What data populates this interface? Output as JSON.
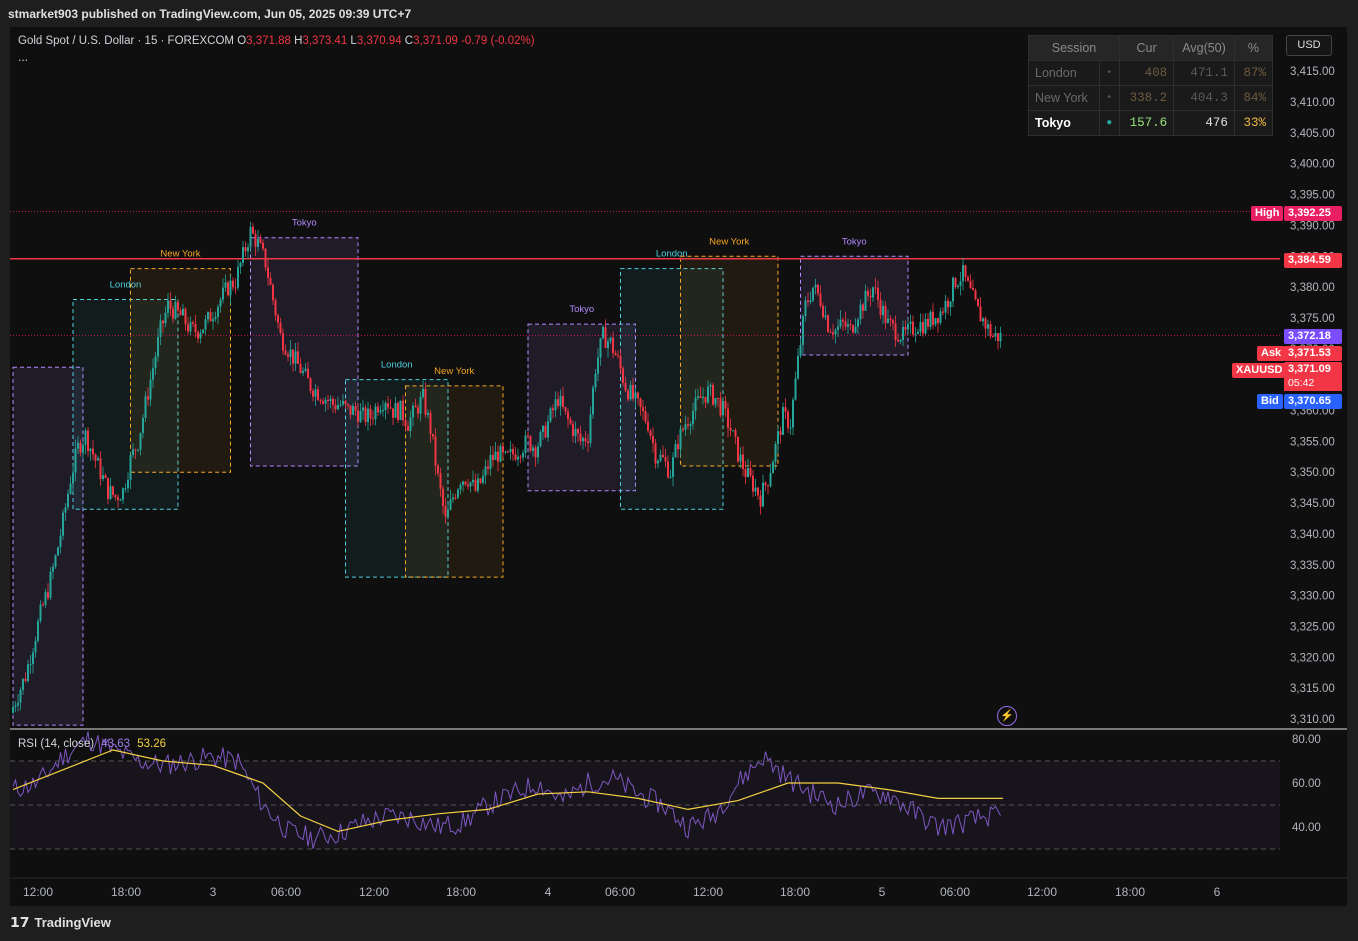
{
  "header": {
    "publisher": "stmarket903 published on TradingView.com, Jun 05, 2025 09:39 UTC+7"
  },
  "footer": {
    "brand": "TradingView",
    "brand_icon": "tradingview-logo-icon"
  },
  "legend": {
    "symbol": "Gold Spot / U.S. Dollar · 15 · FOREXCOM",
    "o_label": "O",
    "o": "3,371.88",
    "h_label": "H",
    "h": "3,373.41",
    "l_label": "L",
    "l": "3,370.94",
    "c_label": "C",
    "c": "3,371.09",
    "chg": "-0.79 (-0.02%)",
    "more": "..."
  },
  "currency": "USD",
  "session_table": {
    "headers": [
      "Session",
      "Cur",
      "Avg(50)",
      "%"
    ],
    "rows": [
      {
        "name": "London",
        "dot": "•",
        "cur": "408",
        "avg": "471.1",
        "pct": "87%",
        "active": false
      },
      {
        "name": "New York",
        "dot": "•",
        "cur": "338.2",
        "avg": "404.3",
        "pct": "84%",
        "active": false
      },
      {
        "name": "Tokyo",
        "dot": "●",
        "cur": "157.6",
        "avg": "476",
        "pct": "33%",
        "active": true
      }
    ]
  },
  "price_labels": {
    "high_tag": "High",
    "high": "3,392.25",
    "level": "3,384.59",
    "purple": "3,372.18",
    "ask_tag": "Ask",
    "ask": "3,371.53",
    "symbol_tag": "XAUUSD",
    "last": "3,371.09",
    "countdown": "05:42",
    "bid_tag": "Bid",
    "bid": "3,370.65"
  },
  "rsi_legend": {
    "label": "RSI (14, close)",
    "rsi": "43.63",
    "ma": "53.26"
  },
  "colors": {
    "up": "#26a69a",
    "down": "#f23645",
    "london": "#4dd0e1",
    "newyork": "#f5a623",
    "tokyo": "#b388ff",
    "rsi": "#7e57c2",
    "rsi_ma": "#f5d142",
    "level": "#f23645"
  },
  "chart_data": {
    "type": "candlestick",
    "title": "Gold Spot / U.S. Dollar · 15 · FOREXCOM",
    "price_axis": {
      "ticks": [
        "3,415.00",
        "3,410.00",
        "3,405.00",
        "3,400.00",
        "3,395.00",
        "3,390.00",
        "3,385.00",
        "3,380.00",
        "3,375.00",
        "3,370.00",
        "3,365.00",
        "3,360.00",
        "3,355.00",
        "3,350.00",
        "3,345.00",
        "3,340.00",
        "3,335.00",
        "3,330.00",
        "3,325.00",
        "3,320.00",
        "3,315.00",
        "3,310.00"
      ],
      "range": [
        3308,
        3418
      ]
    },
    "time_axis": {
      "ticks": [
        "12:00",
        "18:00",
        "3",
        "06:00",
        "12:00",
        "18:00",
        "4",
        "06:00",
        "12:00",
        "18:00",
        "5",
        "06:00",
        "12:00",
        "18:00",
        "6"
      ]
    },
    "horizontal_levels": [
      {
        "value": 3392.25,
        "style": "dotted"
      },
      {
        "value": 3384.59,
        "style": "solid"
      },
      {
        "value": 3372.18,
        "style": "dotted"
      }
    ],
    "close_path": [
      [
        0,
        3311
      ],
      [
        3,
        3314
      ],
      [
        6,
        3317
      ],
      [
        9,
        3322
      ],
      [
        12,
        3327
      ],
      [
        15,
        3331
      ],
      [
        18,
        3336
      ],
      [
        21,
        3342
      ],
      [
        24,
        3349
      ],
      [
        27,
        3354
      ],
      [
        30,
        3356
      ],
      [
        33,
        3353
      ],
      [
        36,
        3350
      ],
      [
        39,
        3347
      ],
      [
        42,
        3346
      ],
      [
        45,
        3347
      ],
      [
        48,
        3352
      ],
      [
        51,
        3355
      ],
      [
        54,
        3361
      ],
      [
        57,
        3367
      ],
      [
        60,
        3373
      ],
      [
        63,
        3377
      ],
      [
        66,
        3376
      ],
      [
        69,
        3375
      ],
      [
        72,
        3373
      ],
      [
        75,
        3373
      ],
      [
        78,
        3374
      ],
      [
        81,
        3376
      ],
      [
        84,
        3378
      ],
      [
        87,
        3380
      ],
      [
        90,
        3381
      ],
      [
        93,
        3385
      ],
      [
        96,
        3389
      ],
      [
        99,
        3387
      ],
      [
        102,
        3384
      ],
      [
        105,
        3378
      ],
      [
        108,
        3372
      ],
      [
        111,
        3370
      ],
      [
        114,
        3368
      ],
      [
        117,
        3366
      ],
      [
        120,
        3364
      ],
      [
        123,
        3363
      ],
      [
        126,
        3362
      ],
      [
        129,
        3361
      ],
      [
        132,
        3361
      ],
      [
        135,
        3360
      ],
      [
        138,
        3360
      ],
      [
        141,
        3359
      ],
      [
        144,
        3359
      ],
      [
        147,
        3361
      ],
      [
        150,
        3362
      ],
      [
        153,
        3360
      ],
      [
        156,
        3360
      ],
      [
        159,
        3358
      ],
      [
        162,
        3360
      ],
      [
        165,
        3362
      ],
      [
        168,
        3357
      ],
      [
        171,
        3349
      ],
      [
        174,
        3342
      ],
      [
        177,
        3346
      ],
      [
        180,
        3349
      ],
      [
        183,
        3349
      ],
      [
        186,
        3347
      ],
      [
        189,
        3349
      ],
      [
        192,
        3352
      ],
      [
        195,
        3353
      ],
      [
        198,
        3352
      ],
      [
        201,
        3353
      ],
      [
        204,
        3354
      ],
      [
        207,
        3355
      ],
      [
        210,
        3354
      ],
      [
        213,
        3356
      ],
      [
        216,
        3359
      ],
      [
        219,
        3362
      ],
      [
        222,
        3359
      ],
      [
        225,
        3357
      ],
      [
        228,
        3355
      ],
      [
        231,
        3356
      ],
      [
        234,
        3367
      ],
      [
        237,
        3372
      ],
      [
        240,
        3371
      ],
      [
        243,
        3368
      ],
      [
        246,
        3364
      ],
      [
        249,
        3362
      ],
      [
        252,
        3360
      ],
      [
        255,
        3358
      ],
      [
        258,
        3353
      ],
      [
        261,
        3352
      ],
      [
        264,
        3350
      ],
      [
        267,
        3355
      ],
      [
        270,
        3358
      ],
      [
        273,
        3360
      ],
      [
        276,
        3362
      ],
      [
        279,
        3363
      ],
      [
        282,
        3362
      ],
      [
        285,
        3360
      ],
      [
        288,
        3357
      ],
      [
        291,
        3353
      ],
      [
        294,
        3350
      ],
      [
        297,
        3348
      ],
      [
        300,
        3346
      ],
      [
        303,
        3349
      ],
      [
        306,
        3354
      ],
      [
        309,
        3359
      ],
      [
        312,
        3358
      ],
      [
        315,
        3368
      ],
      [
        318,
        3377
      ],
      [
        321,
        3380
      ],
      [
        324,
        3378
      ],
      [
        327,
        3374
      ],
      [
        330,
        3373
      ],
      [
        333,
        3374
      ],
      [
        336,
        3373
      ],
      [
        339,
        3376
      ],
      [
        342,
        3378
      ],
      [
        345,
        3380
      ],
      [
        348,
        3377
      ],
      [
        351,
        3374
      ],
      [
        354,
        3373
      ],
      [
        357,
        3372
      ],
      [
        360,
        3373
      ],
      [
        363,
        3374
      ],
      [
        366,
        3374
      ],
      [
        369,
        3375
      ],
      [
        372,
        3376
      ],
      [
        375,
        3378
      ],
      [
        378,
        3381
      ],
      [
        381,
        3382
      ],
      [
        384,
        3379
      ],
      [
        387,
        3376
      ],
      [
        390,
        3374
      ],
      [
        393,
        3372
      ],
      [
        396,
        3372
      ]
    ],
    "sessions": [
      {
        "name": "Tokyo",
        "bar_start": 0,
        "bar_end": 28,
        "high": 3367,
        "low": 3309,
        "labeled": false
      },
      {
        "name": "London",
        "bar_start": 24,
        "bar_end": 66,
        "high": 3378,
        "low": 3344,
        "labeled": true
      },
      {
        "name": "New York",
        "bar_start": 47,
        "bar_end": 87,
        "high": 3383,
        "low": 3350,
        "labeled": true
      },
      {
        "name": "Tokyo",
        "bar_start": 95,
        "bar_end": 138,
        "high": 3388,
        "low": 3351,
        "labeled": true
      },
      {
        "name": "London",
        "bar_start": 133,
        "bar_end": 174,
        "high": 3365,
        "low": 3333,
        "labeled": true
      },
      {
        "name": "New York",
        "bar_start": 157,
        "bar_end": 196,
        "high": 3364,
        "low": 3333,
        "labeled": true
      },
      {
        "name": "Tokyo",
        "bar_start": 206,
        "bar_end": 249,
        "high": 3374,
        "low": 3347,
        "labeled": true
      },
      {
        "name": "London",
        "bar_start": 243,
        "bar_end": 284,
        "high": 3383,
        "low": 3344,
        "labeled": true
      },
      {
        "name": "New York",
        "bar_start": 267,
        "bar_end": 306,
        "high": 3385,
        "low": 3351,
        "labeled": true
      },
      {
        "name": "Tokyo",
        "bar_start": 315,
        "bar_end": 358,
        "high": 3385,
        "low": 3369,
        "labeled": true
      }
    ],
    "rsi": {
      "levels": [
        70,
        50,
        30
      ],
      "axis_ticks": [
        "80.00",
        "60.00",
        "40.00"
      ],
      "range": [
        25,
        85
      ],
      "path": [
        [
          0,
          57
        ],
        [
          10,
          60
        ],
        [
          20,
          72
        ],
        [
          30,
          80
        ],
        [
          40,
          75
        ],
        [
          50,
          70
        ],
        [
          60,
          68
        ],
        [
          70,
          70
        ],
        [
          80,
          72
        ],
        [
          90,
          70
        ],
        [
          100,
          50
        ],
        [
          110,
          38
        ],
        [
          120,
          35
        ],
        [
          130,
          37
        ],
        [
          140,
          42
        ],
        [
          150,
          45
        ],
        [
          160,
          44
        ],
        [
          170,
          40
        ],
        [
          180,
          42
        ],
        [
          190,
          50
        ],
        [
          200,
          55
        ],
        [
          210,
          60
        ],
        [
          220,
          52
        ],
        [
          230,
          60
        ],
        [
          240,
          62
        ],
        [
          250,
          55
        ],
        [
          260,
          50
        ],
        [
          270,
          40
        ],
        [
          280,
          45
        ],
        [
          290,
          60
        ],
        [
          300,
          72
        ],
        [
          310,
          62
        ],
        [
          320,
          55
        ],
        [
          330,
          50
        ],
        [
          340,
          55
        ],
        [
          350,
          55
        ],
        [
          360,
          47
        ],
        [
          370,
          40
        ],
        [
          380,
          42
        ],
        [
          390,
          45
        ],
        [
          396,
          44
        ]
      ],
      "ma_path": [
        [
          0,
          57
        ],
        [
          20,
          66
        ],
        [
          40,
          75
        ],
        [
          60,
          70
        ],
        [
          80,
          68
        ],
        [
          100,
          60
        ],
        [
          115,
          45
        ],
        [
          130,
          38
        ],
        [
          150,
          43
        ],
        [
          170,
          46
        ],
        [
          190,
          48
        ],
        [
          210,
          55
        ],
        [
          230,
          56
        ],
        [
          250,
          53
        ],
        [
          270,
          48
        ],
        [
          290,
          52
        ],
        [
          310,
          60
        ],
        [
          330,
          60
        ],
        [
          350,
          57
        ],
        [
          370,
          53
        ],
        [
          390,
          53
        ],
        [
          396,
          53
        ]
      ]
    }
  }
}
